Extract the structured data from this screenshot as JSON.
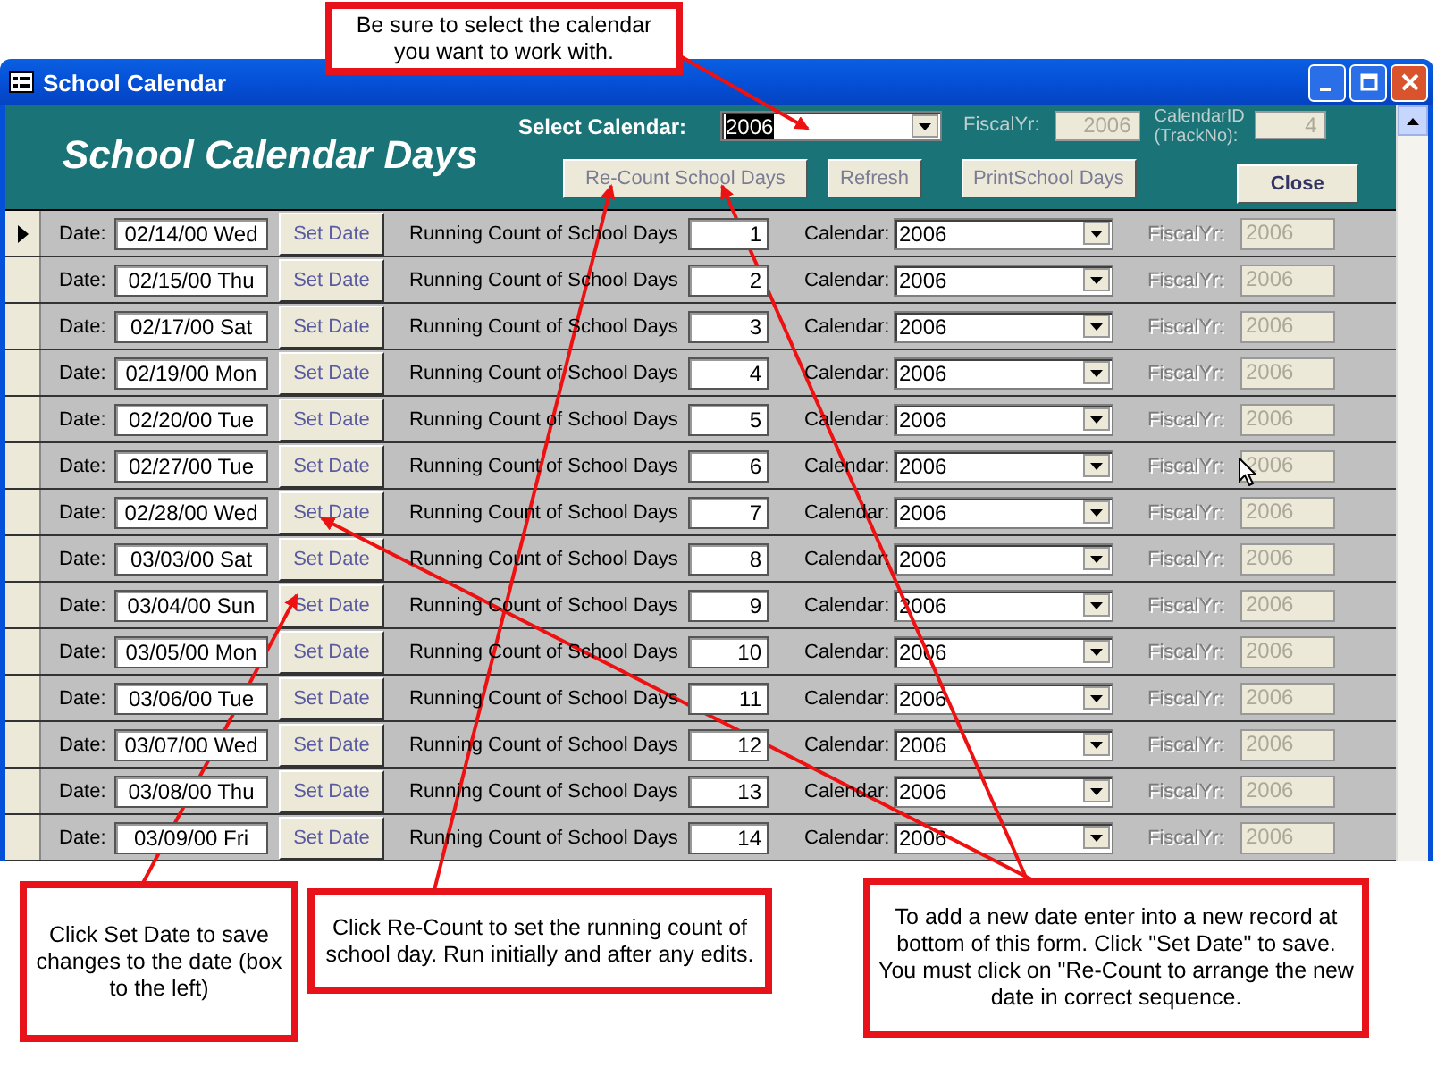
{
  "window": {
    "title": "School Calendar"
  },
  "header": {
    "title": "School Calendar Days",
    "select_label": "Select Calendar:",
    "select_value": "2006",
    "fiscal_label": "FiscalYr:",
    "fiscal_value": "2006",
    "calendar_id_label": "CalendarID (TrackNo):",
    "calendar_id_value": "4",
    "buttons": [
      "Re-Count School Days",
      "Refresh",
      "PrintSchool Days"
    ],
    "close": "Close"
  },
  "rows": [
    {
      "current": true,
      "date_label": "Date:",
      "date": "02/14/00 Wed",
      "button": "Set Date",
      "count_label": "Running Count of School Days",
      "count": "1",
      "calendar_label": "Calendar:",
      "calendar": "2006",
      "fiscal_label": "FiscalYr:",
      "fiscal": "2006"
    },
    {
      "current": false,
      "date_label": "Date:",
      "date": "02/15/00 Thu",
      "button": "Set Date",
      "count_label": "Running Count of School Days",
      "count": "2",
      "calendar_label": "Calendar:",
      "calendar": "2006",
      "fiscal_label": "FiscalYr:",
      "fiscal": "2006"
    },
    {
      "current": false,
      "date_label": "Date:",
      "date": "02/17/00 Sat",
      "button": "Set Date",
      "count_label": "Running Count of School Days",
      "count": "3",
      "calendar_label": "Calendar:",
      "calendar": "2006",
      "fiscal_label": "FiscalYr:",
      "fiscal": "2006"
    },
    {
      "current": false,
      "date_label": "Date:",
      "date": "02/19/00 Mon",
      "button": "Set Date",
      "count_label": "Running Count of School Days",
      "count": "4",
      "calendar_label": "Calendar:",
      "calendar": "2006",
      "fiscal_label": "FiscalYr:",
      "fiscal": "2006"
    },
    {
      "current": false,
      "date_label": "Date:",
      "date": "02/20/00 Tue",
      "button": "Set Date",
      "count_label": "Running Count of School Days",
      "count": "5",
      "calendar_label": "Calendar:",
      "calendar": "2006",
      "fiscal_label": "FiscalYr:",
      "fiscal": "2006"
    },
    {
      "current": false,
      "date_label": "Date:",
      "date": "02/27/00 Tue",
      "button": "Set Date",
      "count_label": "Running Count of School Days",
      "count": "6",
      "calendar_label": "Calendar:",
      "calendar": "2006",
      "fiscal_label": "FiscalYr:",
      "fiscal": "2006"
    },
    {
      "current": false,
      "date_label": "Date:",
      "date": "02/28/00 Wed",
      "button": "Set Date",
      "count_label": "Running Count of School Days",
      "count": "7",
      "calendar_label": "Calendar:",
      "calendar": "2006",
      "fiscal_label": "FiscalYr:",
      "fiscal": "2006"
    },
    {
      "current": false,
      "date_label": "Date:",
      "date": "03/03/00 Sat",
      "button": "Set Date",
      "count_label": "Running Count of School Days",
      "count": "8",
      "calendar_label": "Calendar:",
      "calendar": "2006",
      "fiscal_label": "FiscalYr:",
      "fiscal": "2006"
    },
    {
      "current": false,
      "date_label": "Date:",
      "date": "03/04/00 Sun",
      "button": "Set Date",
      "count_label": "Running Count of School Days",
      "count": "9",
      "calendar_label": "Calendar:",
      "calendar": "2006",
      "fiscal_label": "FiscalYr:",
      "fiscal": "2006"
    },
    {
      "current": false,
      "date_label": "Date:",
      "date": "03/05/00 Mon",
      "button": "Set Date",
      "count_label": "Running Count of School Days",
      "count": "10",
      "calendar_label": "Calendar:",
      "calendar": "2006",
      "fiscal_label": "FiscalYr:",
      "fiscal": "2006"
    },
    {
      "current": false,
      "date_label": "Date:",
      "date": "03/06/00 Tue",
      "button": "Set Date",
      "count_label": "Running Count of School Days",
      "count": "11",
      "calendar_label": "Calendar:",
      "calendar": "2006",
      "fiscal_label": "FiscalYr:",
      "fiscal": "2006"
    },
    {
      "current": false,
      "date_label": "Date:",
      "date": "03/07/00 Wed",
      "button": "Set Date",
      "count_label": "Running Count of School Days",
      "count": "12",
      "calendar_label": "Calendar:",
      "calendar": "2006",
      "fiscal_label": "FiscalYr:",
      "fiscal": "2006"
    },
    {
      "current": false,
      "date_label": "Date:",
      "date": "03/08/00 Thu",
      "button": "Set Date",
      "count_label": "Running Count of School Days",
      "count": "13",
      "calendar_label": "Calendar:",
      "calendar": "2006",
      "fiscal_label": "FiscalYr:",
      "fiscal": "2006"
    },
    {
      "current": false,
      "date_label": "Date:",
      "date": "03/09/00 Fri",
      "button": "Set Date",
      "count_label": "Running Count of School Days",
      "count": "14",
      "calendar_label": "Calendar:",
      "calendar": "2006",
      "fiscal_label": "FiscalYr:",
      "fiscal": "2006"
    }
  ],
  "callouts": [
    {
      "text": "Be sure to select the calendar you want to work with."
    },
    {
      "text": "Click Set Date to save changes to the date (box to the left)"
    },
    {
      "text": "Click Re-Count to set the running count of school day.  Run initially and after any edits."
    },
    {
      "text": "To add a new date enter into a new record at bottom of this form.  Click \"Set Date\" to save.  You must click on \"Re-Count to arrange the new date in correct sequence."
    }
  ]
}
